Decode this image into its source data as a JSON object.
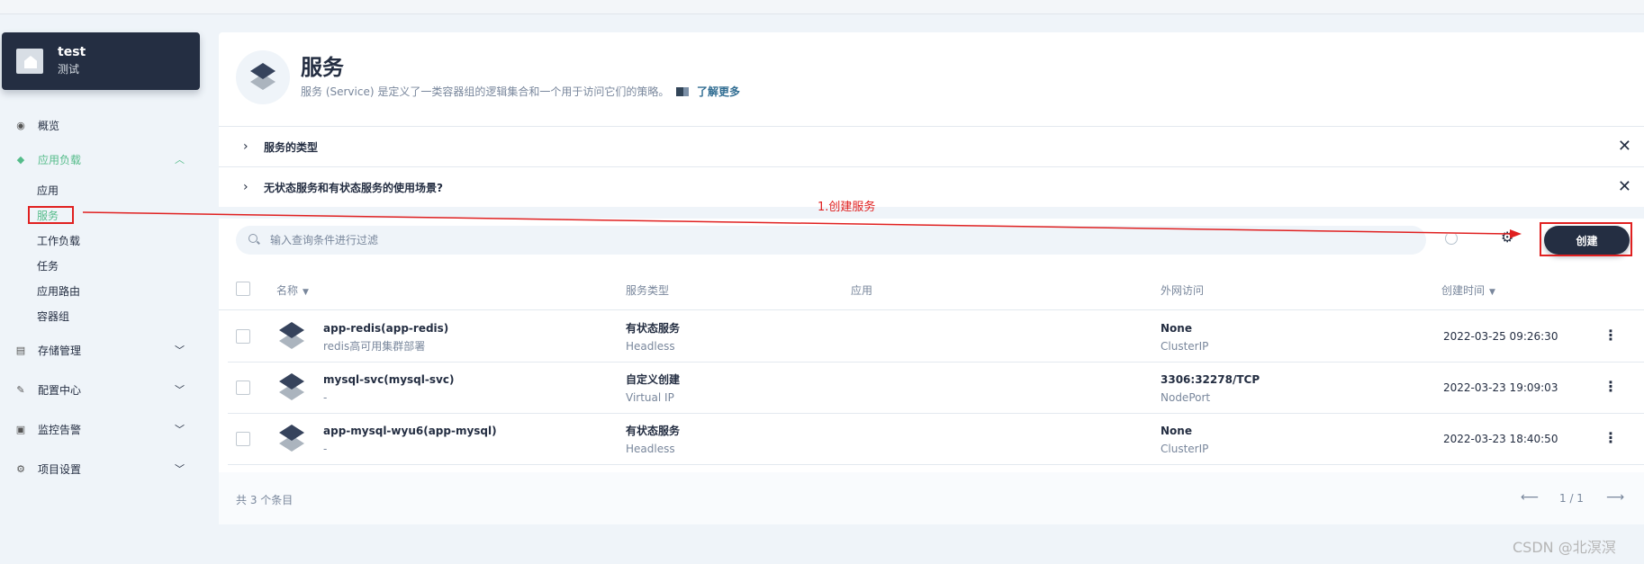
{
  "project": {
    "name": "test",
    "description": "测试"
  },
  "sidebar": {
    "items": [
      {
        "label": "概览",
        "icon": "dashboard-icon"
      },
      {
        "label": "应用负载",
        "icon": "layers-icon",
        "expanded": true
      },
      {
        "label": "存储管理",
        "icon": "database-icon"
      },
      {
        "label": "配置中心",
        "icon": "wrench-icon"
      },
      {
        "label": "监控告警",
        "icon": "monitor-icon"
      },
      {
        "label": "项目设置",
        "icon": "gear-icon"
      }
    ],
    "sub_items": [
      "应用",
      "服务",
      "工作负载",
      "任务",
      "应用路由",
      "容器组"
    ],
    "active_sub": "服务",
    "active_color": "#55bc8a"
  },
  "banner": {
    "title": "服务",
    "description": "服务 (Service) 是定义了一类容器组的逻辑集合和一个用于访问它们的策略。",
    "learn_more": "了解更多"
  },
  "tips": [
    {
      "title": "服务的类型"
    },
    {
      "title": "无状态服务和有状态服务的使用场景?"
    }
  ],
  "toolbar": {
    "search_placeholder": "输入查询条件进行过滤",
    "create_label": "创建"
  },
  "table": {
    "columns": [
      "名称",
      "服务类型",
      "应用",
      "外网访问",
      "创建时间"
    ],
    "rows": [
      {
        "name": "app-redis(app-redis)",
        "desc": "redis高可用集群部署",
        "type": "有状态服务",
        "type_sub": "Headless",
        "app": "",
        "access": "None",
        "access_sub": "ClusterIP",
        "created": "2022-03-25 09:26:30"
      },
      {
        "name": "mysql-svc(mysql-svc)",
        "desc": "-",
        "type": "自定义创建",
        "type_sub": "Virtual IP",
        "app": "",
        "access": "3306:32278/TCP",
        "access_sub": "NodePort",
        "created": "2022-03-23 19:09:03"
      },
      {
        "name": "app-mysql-wyu6(app-mysql)",
        "desc": "-",
        "type": "有状态服务",
        "type_sub": "Headless",
        "app": "",
        "access": "None",
        "access_sub": "ClusterIP",
        "created": "2022-03-23 18:40:50"
      }
    ]
  },
  "footer": {
    "total": "共 3 个条目",
    "page": "1 / 1"
  },
  "annotation": {
    "text": "1.创建服务",
    "color": "#e02020"
  },
  "watermark": "CSDN @北溟溟"
}
